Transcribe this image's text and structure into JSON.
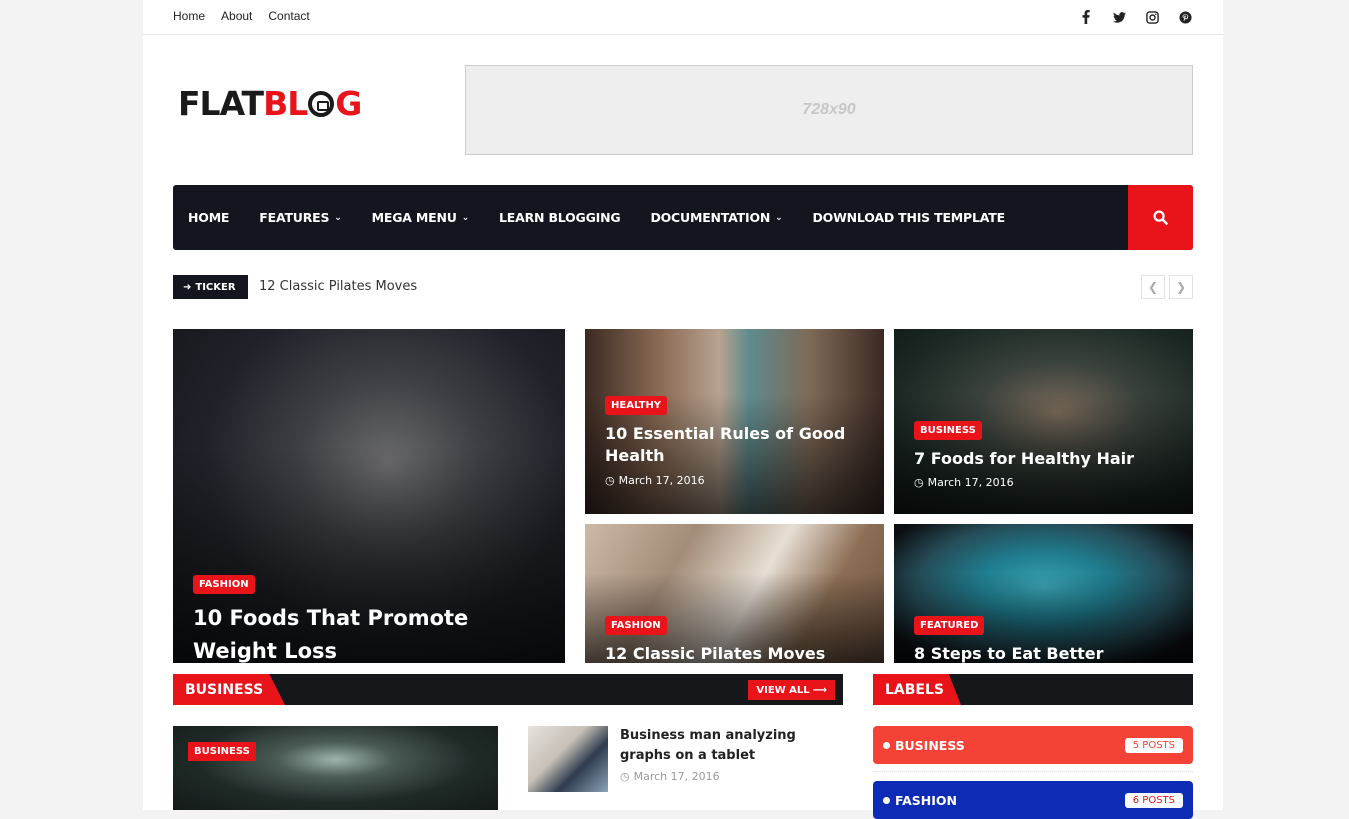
{
  "topbar": {
    "links": [
      "Home",
      "About",
      "Contact"
    ],
    "social": [
      "facebook-icon",
      "twitter-icon",
      "instagram-icon",
      "pinterest-icon"
    ]
  },
  "header": {
    "logo_part1": "FLAT",
    "logo_part2": "BL",
    "logo_part3": "G",
    "ad_text": "728x90"
  },
  "nav": {
    "items": [
      {
        "label": "HOME",
        "dropdown": false
      },
      {
        "label": "FEATURES",
        "dropdown": true
      },
      {
        "label": "MEGA MENU",
        "dropdown": true
      },
      {
        "label": "LEARN BLOGGING",
        "dropdown": false
      },
      {
        "label": "DOCUMENTATION",
        "dropdown": true
      },
      {
        "label": "DOWNLOAD THIS TEMPLATE",
        "dropdown": false
      }
    ],
    "search_icon": "search-icon"
  },
  "ticker": {
    "label": "TICKER",
    "text": "12 Classic Pilates Moves"
  },
  "featured": [
    {
      "tag": "FASHION",
      "title": "10 Foods That Promote Weight Loss",
      "date": ""
    },
    {
      "tag": "HEALTHY",
      "title": "10 Essential Rules of Good Health",
      "date": "March 17, 2016"
    },
    {
      "tag": "BUSINESS",
      "title": "7 Foods for Healthy Hair",
      "date": "March 17, 2016"
    },
    {
      "tag": "FASHION",
      "title": "12 Classic Pilates Moves",
      "date": ""
    },
    {
      "tag": "FEATURED",
      "title": "8 Steps to Eat Better",
      "date": ""
    }
  ],
  "business": {
    "heading": "BUSINESS",
    "view_all": "VIEW ALL",
    "big_tag": "BUSINESS",
    "item": {
      "title": "Business man analyzing graphs on a tablet",
      "date": "March 17, 2016"
    }
  },
  "labels": {
    "heading": "LABELS",
    "items": [
      {
        "name": "BUSINESS",
        "count": "5 POSTS",
        "color": "#f44336"
      },
      {
        "name": "FASHION",
        "count": "6 POSTS",
        "color": "#0e2bb5"
      }
    ]
  },
  "colors": {
    "accent": "#e8141a",
    "nav_bg": "#13151f"
  }
}
